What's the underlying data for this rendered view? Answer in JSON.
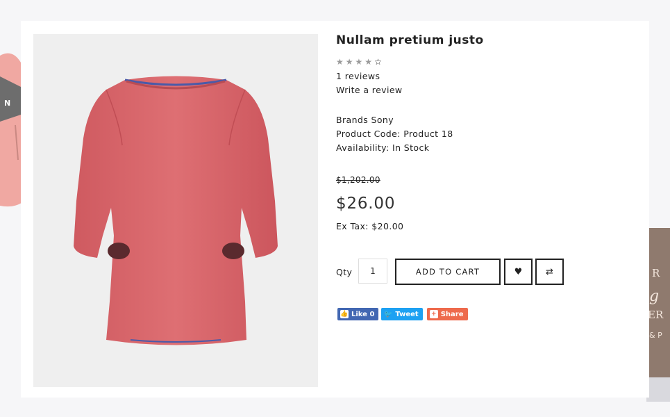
{
  "product": {
    "title": "Nullam pretium justo",
    "rating": 4,
    "rating_max": 5,
    "reviews_link": "1 reviews",
    "write_review_link": "Write a review",
    "brand_label": "Brands Sony",
    "product_code": "Product Code: Product 18",
    "availability": "Availability: In Stock",
    "old_price": "$1,202.00",
    "price": "$26.00",
    "ex_tax": "Ex Tax: $20.00"
  },
  "cart": {
    "qty_label": "Qty",
    "qty_value": "1",
    "add_to_cart_label": "ADD TO CART",
    "wishlist_icon": "heart-icon",
    "compare_icon": "compare-arrows-icon"
  },
  "social": {
    "facebook_label": "Like 0",
    "twitter_label": "Tweet",
    "share_label": "Share"
  },
  "colors": {
    "shirt": "#d8646a",
    "facebook": "#4267b2",
    "twitter": "#1da1f2",
    "share": "#ee6a4c"
  }
}
